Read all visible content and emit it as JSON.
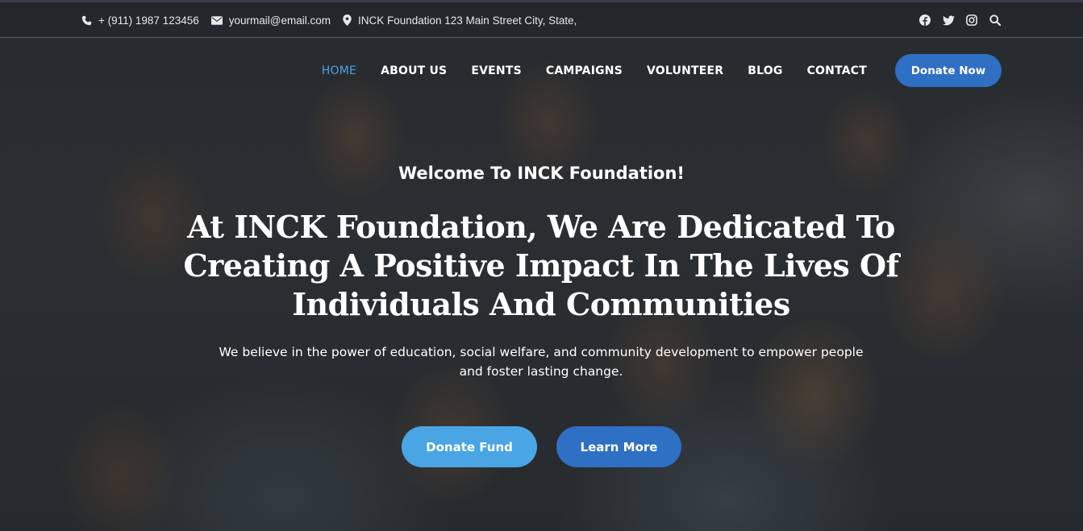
{
  "topbar": {
    "phone": "+ (911) 1987 123456",
    "email": "yourmail@email.com",
    "address": "INCK Foundation 123 Main Street City, State,",
    "socials": [
      "facebook-icon",
      "twitter-icon",
      "instagram-icon",
      "search-icon"
    ]
  },
  "nav": {
    "items": [
      {
        "label": "HOME",
        "active": true
      },
      {
        "label": "ABOUT US"
      },
      {
        "label": "EVENTS"
      },
      {
        "label": "CAMPAIGNS"
      },
      {
        "label": "VOLUNTEER"
      },
      {
        "label": "BLOG"
      },
      {
        "label": "CONTACT"
      }
    ],
    "donate_label": "Donate Now"
  },
  "hero": {
    "welcome": "Welcome To INCK Foundation!",
    "headline": "At INCK Foundation, We Are Dedicated To Creating A Positive Impact In The Lives Of Individuals And Communities",
    "subtext": "We believe in the power of education, social welfare, and community development to empower people and foster lasting change.",
    "fund_label": "Donate Fund",
    "learn_label": "Learn More"
  },
  "colors": {
    "accent": "#2f6fc4",
    "accent_light": "#49a5e4",
    "nav_active": "#4aa5e0"
  }
}
